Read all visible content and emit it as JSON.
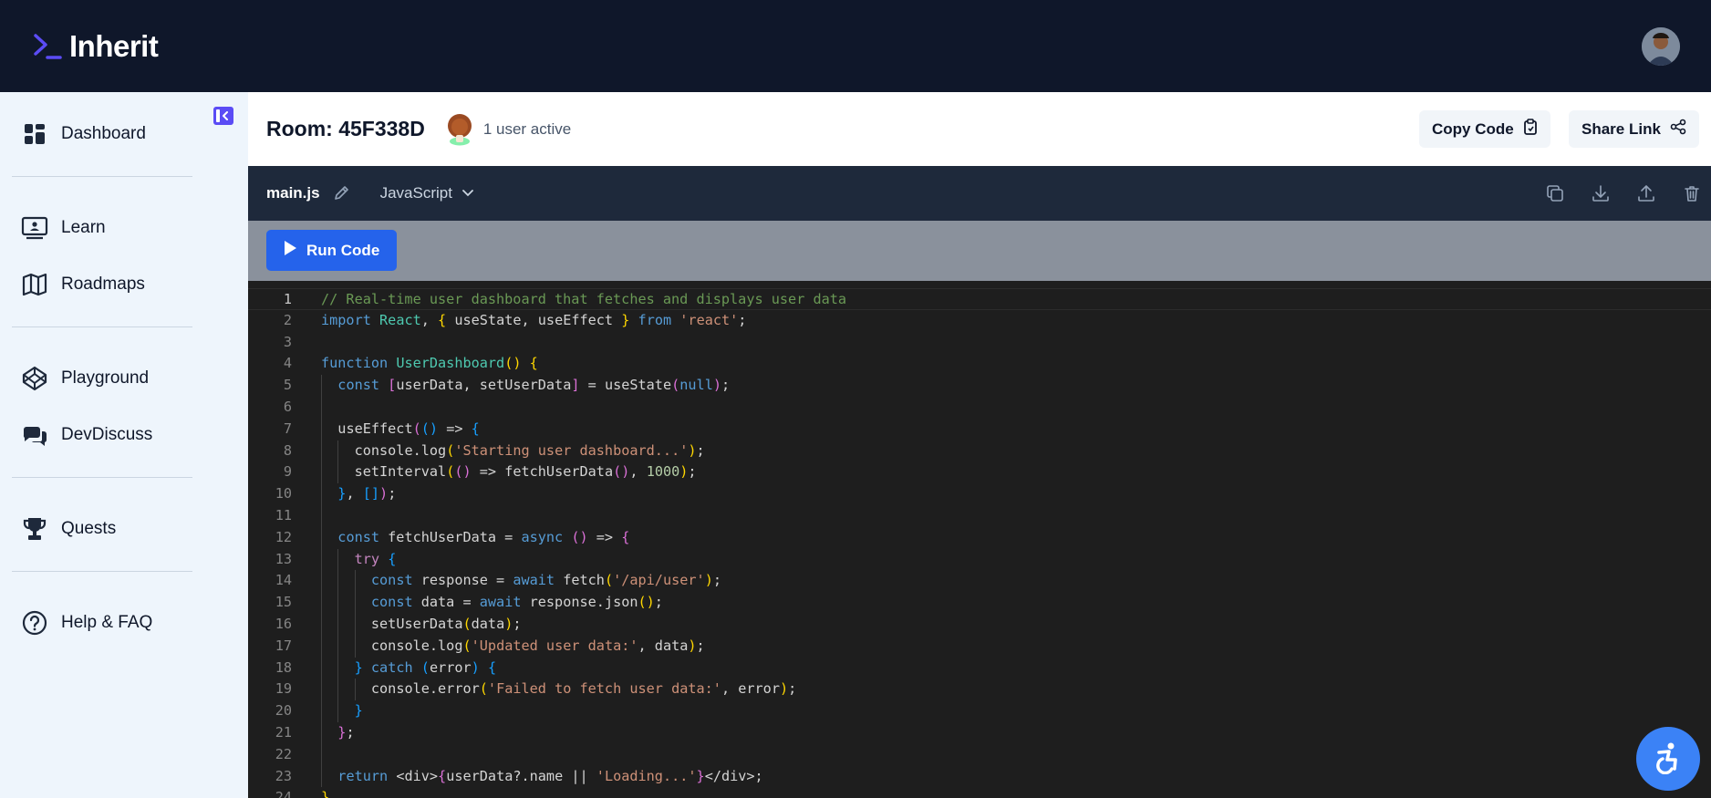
{
  "app": {
    "logo_text": "Inherit",
    "accent": "#5b4cf5"
  },
  "sidebar": {
    "items": [
      {
        "label": "Dashboard",
        "icon": "dashboard-icon"
      },
      {
        "label": "Learn",
        "icon": "learn-icon"
      },
      {
        "label": "Roadmaps",
        "icon": "map-icon"
      },
      {
        "label": "Playground",
        "icon": "codepen-icon"
      },
      {
        "label": "DevDiscuss",
        "icon": "chat-bubbles-icon"
      },
      {
        "label": "Quests",
        "icon": "trophy-icon"
      },
      {
        "label": "Help & FAQ",
        "icon": "help-circle-icon"
      }
    ]
  },
  "room": {
    "title": "Room: 45F338D",
    "active_users": "1 user active",
    "copy_code_label": "Copy Code",
    "share_link_label": "Share Link"
  },
  "file": {
    "name": "main.js",
    "language": "JavaScript"
  },
  "run": {
    "label": "Run Code"
  },
  "editor": {
    "current_line": 1,
    "lines": [
      {
        "n": "1",
        "indent": 0,
        "tokens": [
          [
            "cm",
            "// Real-time user dashboard that fetches and displays user data"
          ]
        ]
      },
      {
        "n": "2",
        "indent": 0,
        "tokens": [
          [
            "kw",
            "import"
          ],
          [
            "txt",
            " "
          ],
          [
            "cls",
            "React"
          ],
          [
            "txt",
            ", "
          ],
          [
            "b1",
            "{"
          ],
          [
            "txt",
            " useState, useEffect "
          ],
          [
            "b1",
            "}"
          ],
          [
            "txt",
            " "
          ],
          [
            "kw",
            "from"
          ],
          [
            "txt",
            " "
          ],
          [
            "str",
            "'react'"
          ],
          [
            "txt",
            ";"
          ]
        ]
      },
      {
        "n": "3",
        "indent": 0,
        "tokens": []
      },
      {
        "n": "4",
        "indent": 0,
        "tokens": [
          [
            "kw",
            "function"
          ],
          [
            "txt",
            " "
          ],
          [
            "cls",
            "UserDashboard"
          ],
          [
            "b1",
            "()"
          ],
          [
            "txt",
            " "
          ],
          [
            "b1",
            "{"
          ]
        ]
      },
      {
        "n": "5",
        "indent": 1,
        "tokens": [
          [
            "kw",
            "const"
          ],
          [
            "txt",
            " "
          ],
          [
            "b2",
            "["
          ],
          [
            "txt",
            "userData, setUserData"
          ],
          [
            "b2",
            "]"
          ],
          [
            "txt",
            " = useState"
          ],
          [
            "b2",
            "("
          ],
          [
            "kw",
            "null"
          ],
          [
            "b2",
            ")"
          ],
          [
            "txt",
            ";"
          ]
        ]
      },
      {
        "n": "6",
        "indent": 1,
        "tokens": []
      },
      {
        "n": "7",
        "indent": 1,
        "tokens": [
          [
            "txt",
            "useEffect"
          ],
          [
            "b2",
            "("
          ],
          [
            "b3",
            "()"
          ],
          [
            "txt",
            " => "
          ],
          [
            "b3",
            "{"
          ]
        ]
      },
      {
        "n": "8",
        "indent": 2,
        "tokens": [
          [
            "txt",
            "console.log"
          ],
          [
            "b1",
            "("
          ],
          [
            "str",
            "'Starting user dashboard...'"
          ],
          [
            "b1",
            ")"
          ],
          [
            "txt",
            ";"
          ]
        ]
      },
      {
        "n": "9",
        "indent": 2,
        "tokens": [
          [
            "txt",
            "setInterval"
          ],
          [
            "b1",
            "("
          ],
          [
            "b2",
            "()"
          ],
          [
            "txt",
            " => fetchUserData"
          ],
          [
            "b2",
            "()"
          ],
          [
            "txt",
            ", "
          ],
          [
            "num",
            "1000"
          ],
          [
            "b1",
            ")"
          ],
          [
            "txt",
            ";"
          ]
        ]
      },
      {
        "n": "10",
        "indent": 1,
        "tokens": [
          [
            "b3",
            "}"
          ],
          [
            "txt",
            ", "
          ],
          [
            "b3",
            "[]"
          ],
          [
            "b2",
            ")"
          ],
          [
            "txt",
            ";"
          ]
        ]
      },
      {
        "n": "11",
        "indent": 1,
        "tokens": []
      },
      {
        "n": "12",
        "indent": 1,
        "tokens": [
          [
            "kw",
            "const"
          ],
          [
            "txt",
            " fetchUserData = "
          ],
          [
            "kw",
            "async"
          ],
          [
            "txt",
            " "
          ],
          [
            "b2",
            "()"
          ],
          [
            "txt",
            " => "
          ],
          [
            "b2",
            "{"
          ]
        ]
      },
      {
        "n": "13",
        "indent": 2,
        "tokens": [
          [
            "kc",
            "try"
          ],
          [
            "txt",
            " "
          ],
          [
            "b3",
            "{"
          ]
        ]
      },
      {
        "n": "14",
        "indent": 3,
        "tokens": [
          [
            "kw",
            "const"
          ],
          [
            "txt",
            " response = "
          ],
          [
            "kw",
            "await"
          ],
          [
            "txt",
            " fetch"
          ],
          [
            "b1",
            "("
          ],
          [
            "str",
            "'/api/user'"
          ],
          [
            "b1",
            ")"
          ],
          [
            "txt",
            ";"
          ]
        ]
      },
      {
        "n": "15",
        "indent": 3,
        "tokens": [
          [
            "kw",
            "const"
          ],
          [
            "txt",
            " data = "
          ],
          [
            "kw",
            "await"
          ],
          [
            "txt",
            " response.json"
          ],
          [
            "b1",
            "()"
          ],
          [
            "txt",
            ";"
          ]
        ]
      },
      {
        "n": "16",
        "indent": 3,
        "tokens": [
          [
            "txt",
            "setUserData"
          ],
          [
            "b1",
            "("
          ],
          [
            "txt",
            "data"
          ],
          [
            "b1",
            ")"
          ],
          [
            "txt",
            ";"
          ]
        ]
      },
      {
        "n": "17",
        "indent": 3,
        "tokens": [
          [
            "txt",
            "console.log"
          ],
          [
            "b1",
            "("
          ],
          [
            "str",
            "'Updated user data:'"
          ],
          [
            "txt",
            ", data"
          ],
          [
            "b1",
            ")"
          ],
          [
            "txt",
            ";"
          ]
        ]
      },
      {
        "n": "18",
        "indent": 2,
        "tokens": [
          [
            "b3",
            "}"
          ],
          [
            "txt",
            " "
          ],
          [
            "kw",
            "catch"
          ],
          [
            "txt",
            " "
          ],
          [
            "b3",
            "("
          ],
          [
            "txt",
            "error"
          ],
          [
            "b3",
            ")"
          ],
          [
            "txt",
            " "
          ],
          [
            "b3",
            "{"
          ]
        ]
      },
      {
        "n": "19",
        "indent": 3,
        "tokens": [
          [
            "txt",
            "console.error"
          ],
          [
            "b1",
            "("
          ],
          [
            "str",
            "'Failed to fetch user data:'"
          ],
          [
            "txt",
            ", error"
          ],
          [
            "b1",
            ")"
          ],
          [
            "txt",
            ";"
          ]
        ]
      },
      {
        "n": "20",
        "indent": 2,
        "tokens": [
          [
            "b3",
            "}"
          ]
        ]
      },
      {
        "n": "21",
        "indent": 1,
        "tokens": [
          [
            "b2",
            "}"
          ],
          [
            "txt",
            ";"
          ]
        ]
      },
      {
        "n": "22",
        "indent": 1,
        "tokens": []
      },
      {
        "n": "23",
        "indent": 1,
        "tokens": [
          [
            "kw",
            "return"
          ],
          [
            "txt",
            " <div>"
          ],
          [
            "b2",
            "{"
          ],
          [
            "txt",
            "userData?.name || "
          ],
          [
            "str",
            "'Loading...'"
          ],
          [
            "b2",
            "}"
          ],
          [
            "txt",
            "</div>;"
          ]
        ]
      },
      {
        "n": "24",
        "indent": 0,
        "tokens": [
          [
            "b1",
            "}"
          ]
        ]
      }
    ]
  }
}
